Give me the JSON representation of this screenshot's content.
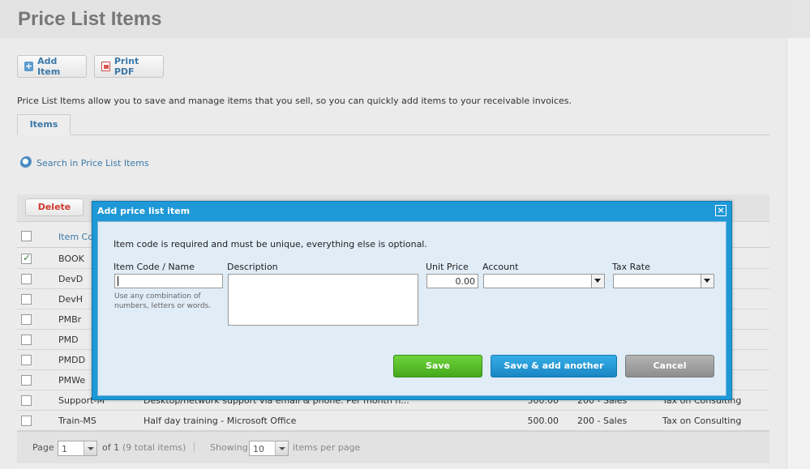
{
  "page": {
    "title": "Price List Items",
    "add_item_label": "Add Item",
    "print_pdf_label": "Print PDF",
    "intro": "Price List Items allow you to save and manage items that you sell, so you can quickly add items to your receivable invoices.",
    "tab_items": "Items",
    "search_link": "Search in Price List Items"
  },
  "grid": {
    "delete_label": "Delete",
    "header_code": "Item Code",
    "rows": [
      {
        "code": "BOOK",
        "checked": true,
        "desc": "",
        "price": "",
        "account": "",
        "tax": ""
      },
      {
        "code": "DevD",
        "checked": false,
        "desc": "",
        "price": "",
        "account": "",
        "tax": ""
      },
      {
        "code": "DevH",
        "checked": false,
        "desc": "",
        "price": "",
        "account": "",
        "tax": ""
      },
      {
        "code": "PMBr",
        "checked": false,
        "desc": "",
        "price": "",
        "account": "",
        "tax": ""
      },
      {
        "code": "PMD",
        "checked": false,
        "desc": "",
        "price": "",
        "account": "",
        "tax": ""
      },
      {
        "code": "PMDD",
        "checked": false,
        "desc": "",
        "price": "",
        "account": "",
        "tax": ""
      },
      {
        "code": "PMWe",
        "checked": false,
        "desc": "",
        "price": "",
        "account": "",
        "tax": ""
      },
      {
        "code": "Support-M",
        "checked": false,
        "desc": "Desktop/network support via email & phone. Per month n...",
        "price": "500.00",
        "account": "200 - Sales",
        "tax": "Tax on Consulting"
      },
      {
        "code": "Train-MS",
        "checked": false,
        "desc": "Half day training - Microsoft Office",
        "price": "500.00",
        "account": "200 - Sales",
        "tax": "Tax on Consulting"
      }
    ]
  },
  "pager": {
    "page_label": "Page",
    "page_value": "1",
    "of_label": "of 1",
    "total_label": "(9 total items)",
    "showing_label": "Showing",
    "per_page_value": "10",
    "per_page_label": "items per page"
  },
  "dialog": {
    "title": "Add price list item",
    "close_icon": "×",
    "note": "Item code is required and must be unique, everything else is optional.",
    "label_code": "Item Code / Name",
    "label_desc": "Description",
    "label_price": "Unit Price",
    "label_account": "Account",
    "label_tax": "Tax Rate",
    "code_hint": "Use any combination of numbers, letters or words.",
    "price_value": "0.00",
    "save_label": "Save",
    "save_add_label": "Save & add another",
    "cancel_label": "Cancel"
  },
  "colors": {
    "dialog_frame": "#1e98d6",
    "save_green": "#45a81c",
    "save_add_blue": "#1a86c4",
    "cancel_gray": "#8e8e8e",
    "link_blue": "#3a78a8",
    "delete_red": "#d03a2f"
  }
}
